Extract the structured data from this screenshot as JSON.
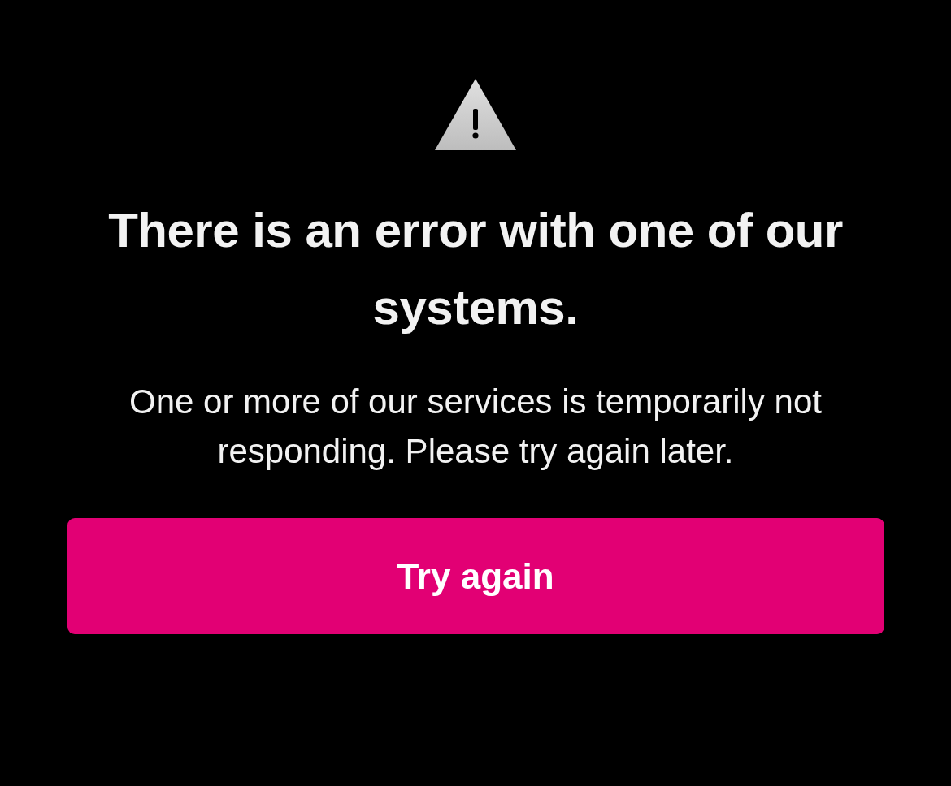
{
  "title": "There is an error with one of our systems.",
  "message": "One or more of our services is temporarily not responding. Please try again later.",
  "button": {
    "label": "Try again"
  }
}
